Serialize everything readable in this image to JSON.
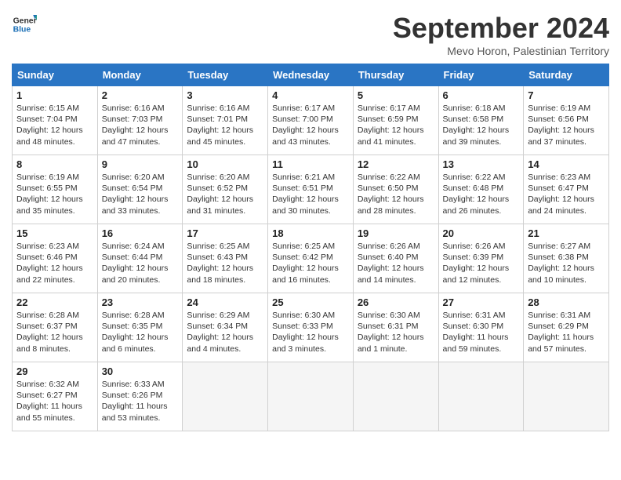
{
  "logo": {
    "line1": "General",
    "line2": "Blue"
  },
  "title": "September 2024",
  "location": "Mevo Horon, Palestinian Territory",
  "days_of_week": [
    "Sunday",
    "Monday",
    "Tuesday",
    "Wednesday",
    "Thursday",
    "Friday",
    "Saturday"
  ],
  "weeks": [
    [
      {
        "num": "1",
        "info": "Sunrise: 6:15 AM\nSunset: 7:04 PM\nDaylight: 12 hours\nand 48 minutes."
      },
      {
        "num": "2",
        "info": "Sunrise: 6:16 AM\nSunset: 7:03 PM\nDaylight: 12 hours\nand 47 minutes."
      },
      {
        "num": "3",
        "info": "Sunrise: 6:16 AM\nSunset: 7:01 PM\nDaylight: 12 hours\nand 45 minutes."
      },
      {
        "num": "4",
        "info": "Sunrise: 6:17 AM\nSunset: 7:00 PM\nDaylight: 12 hours\nand 43 minutes."
      },
      {
        "num": "5",
        "info": "Sunrise: 6:17 AM\nSunset: 6:59 PM\nDaylight: 12 hours\nand 41 minutes."
      },
      {
        "num": "6",
        "info": "Sunrise: 6:18 AM\nSunset: 6:58 PM\nDaylight: 12 hours\nand 39 minutes."
      },
      {
        "num": "7",
        "info": "Sunrise: 6:19 AM\nSunset: 6:56 PM\nDaylight: 12 hours\nand 37 minutes."
      }
    ],
    [
      {
        "num": "8",
        "info": "Sunrise: 6:19 AM\nSunset: 6:55 PM\nDaylight: 12 hours\nand 35 minutes."
      },
      {
        "num": "9",
        "info": "Sunrise: 6:20 AM\nSunset: 6:54 PM\nDaylight: 12 hours\nand 33 minutes."
      },
      {
        "num": "10",
        "info": "Sunrise: 6:20 AM\nSunset: 6:52 PM\nDaylight: 12 hours\nand 31 minutes."
      },
      {
        "num": "11",
        "info": "Sunrise: 6:21 AM\nSunset: 6:51 PM\nDaylight: 12 hours\nand 30 minutes."
      },
      {
        "num": "12",
        "info": "Sunrise: 6:22 AM\nSunset: 6:50 PM\nDaylight: 12 hours\nand 28 minutes."
      },
      {
        "num": "13",
        "info": "Sunrise: 6:22 AM\nSunset: 6:48 PM\nDaylight: 12 hours\nand 26 minutes."
      },
      {
        "num": "14",
        "info": "Sunrise: 6:23 AM\nSunset: 6:47 PM\nDaylight: 12 hours\nand 24 minutes."
      }
    ],
    [
      {
        "num": "15",
        "info": "Sunrise: 6:23 AM\nSunset: 6:46 PM\nDaylight: 12 hours\nand 22 minutes."
      },
      {
        "num": "16",
        "info": "Sunrise: 6:24 AM\nSunset: 6:44 PM\nDaylight: 12 hours\nand 20 minutes."
      },
      {
        "num": "17",
        "info": "Sunrise: 6:25 AM\nSunset: 6:43 PM\nDaylight: 12 hours\nand 18 minutes."
      },
      {
        "num": "18",
        "info": "Sunrise: 6:25 AM\nSunset: 6:42 PM\nDaylight: 12 hours\nand 16 minutes."
      },
      {
        "num": "19",
        "info": "Sunrise: 6:26 AM\nSunset: 6:40 PM\nDaylight: 12 hours\nand 14 minutes."
      },
      {
        "num": "20",
        "info": "Sunrise: 6:26 AM\nSunset: 6:39 PM\nDaylight: 12 hours\nand 12 minutes."
      },
      {
        "num": "21",
        "info": "Sunrise: 6:27 AM\nSunset: 6:38 PM\nDaylight: 12 hours\nand 10 minutes."
      }
    ],
    [
      {
        "num": "22",
        "info": "Sunrise: 6:28 AM\nSunset: 6:37 PM\nDaylight: 12 hours\nand 8 minutes."
      },
      {
        "num": "23",
        "info": "Sunrise: 6:28 AM\nSunset: 6:35 PM\nDaylight: 12 hours\nand 6 minutes."
      },
      {
        "num": "24",
        "info": "Sunrise: 6:29 AM\nSunset: 6:34 PM\nDaylight: 12 hours\nand 4 minutes."
      },
      {
        "num": "25",
        "info": "Sunrise: 6:30 AM\nSunset: 6:33 PM\nDaylight: 12 hours\nand 3 minutes."
      },
      {
        "num": "26",
        "info": "Sunrise: 6:30 AM\nSunset: 6:31 PM\nDaylight: 12 hours\nand 1 minute."
      },
      {
        "num": "27",
        "info": "Sunrise: 6:31 AM\nSunset: 6:30 PM\nDaylight: 11 hours\nand 59 minutes."
      },
      {
        "num": "28",
        "info": "Sunrise: 6:31 AM\nSunset: 6:29 PM\nDaylight: 11 hours\nand 57 minutes."
      }
    ],
    [
      {
        "num": "29",
        "info": "Sunrise: 6:32 AM\nSunset: 6:27 PM\nDaylight: 11 hours\nand 55 minutes."
      },
      {
        "num": "30",
        "info": "Sunrise: 6:33 AM\nSunset: 6:26 PM\nDaylight: 11 hours\nand 53 minutes."
      },
      {
        "num": "",
        "info": ""
      },
      {
        "num": "",
        "info": ""
      },
      {
        "num": "",
        "info": ""
      },
      {
        "num": "",
        "info": ""
      },
      {
        "num": "",
        "info": ""
      }
    ]
  ]
}
